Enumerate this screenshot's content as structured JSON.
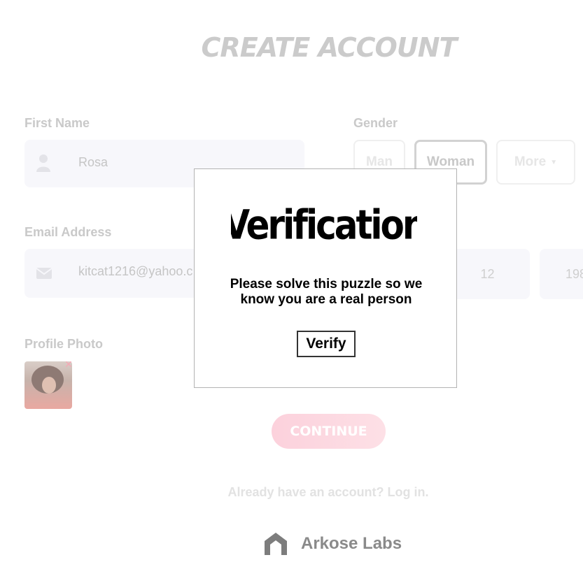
{
  "page": {
    "title": "CREATE ACCOUNT",
    "first_name": {
      "label": "First Name",
      "value": "Rosa"
    },
    "email": {
      "label": "Email Address",
      "value": "kitcat1216@yahoo.c"
    },
    "gender": {
      "label": "Gender",
      "options": [
        "Man",
        "Woman",
        "More"
      ],
      "selected": "Woman"
    },
    "birthday": {
      "day": "12",
      "year": "198"
    },
    "profile_photo": {
      "label": "Profile Photo"
    },
    "continue_label": "CONTINUE",
    "login_text": "Already have an account? Log in."
  },
  "brand": {
    "name": "Arkose Labs"
  },
  "modal": {
    "title": "Verification",
    "message_line1": "Please solve this puzzle so we",
    "message_line2": "know you are a real person",
    "button": "Verify"
  }
}
